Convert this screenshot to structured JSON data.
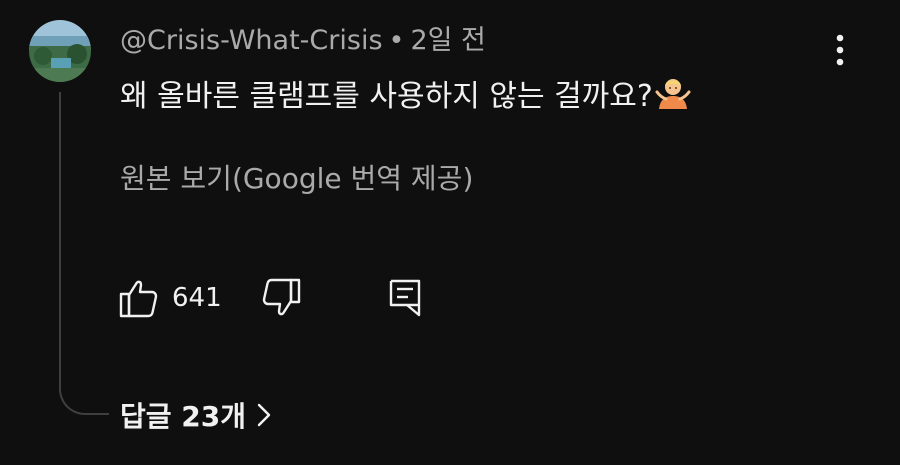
{
  "comment": {
    "author": "@Crisis-What-Crisis",
    "separator": "•",
    "time": "2일 전",
    "text": "왜 올바른 클램프를 사용하지 않는 걸까요?",
    "emoji": "person-shrugging",
    "translate_link": "원본 보기(Google 번역 제공)",
    "likes": "641",
    "replies_label": "답글 23개"
  },
  "icons": {
    "like": "thumbs-up-icon",
    "dislike": "thumbs-down-icon",
    "reply": "reply-comment-icon",
    "more": "more-vertical-icon",
    "chevron": "chevron-right-icon"
  },
  "colors": {
    "background": "#0f0f0f",
    "text_primary": "#f1f1f1",
    "text_secondary": "#aaaaaa",
    "thread_line": "#3f3f3f"
  }
}
